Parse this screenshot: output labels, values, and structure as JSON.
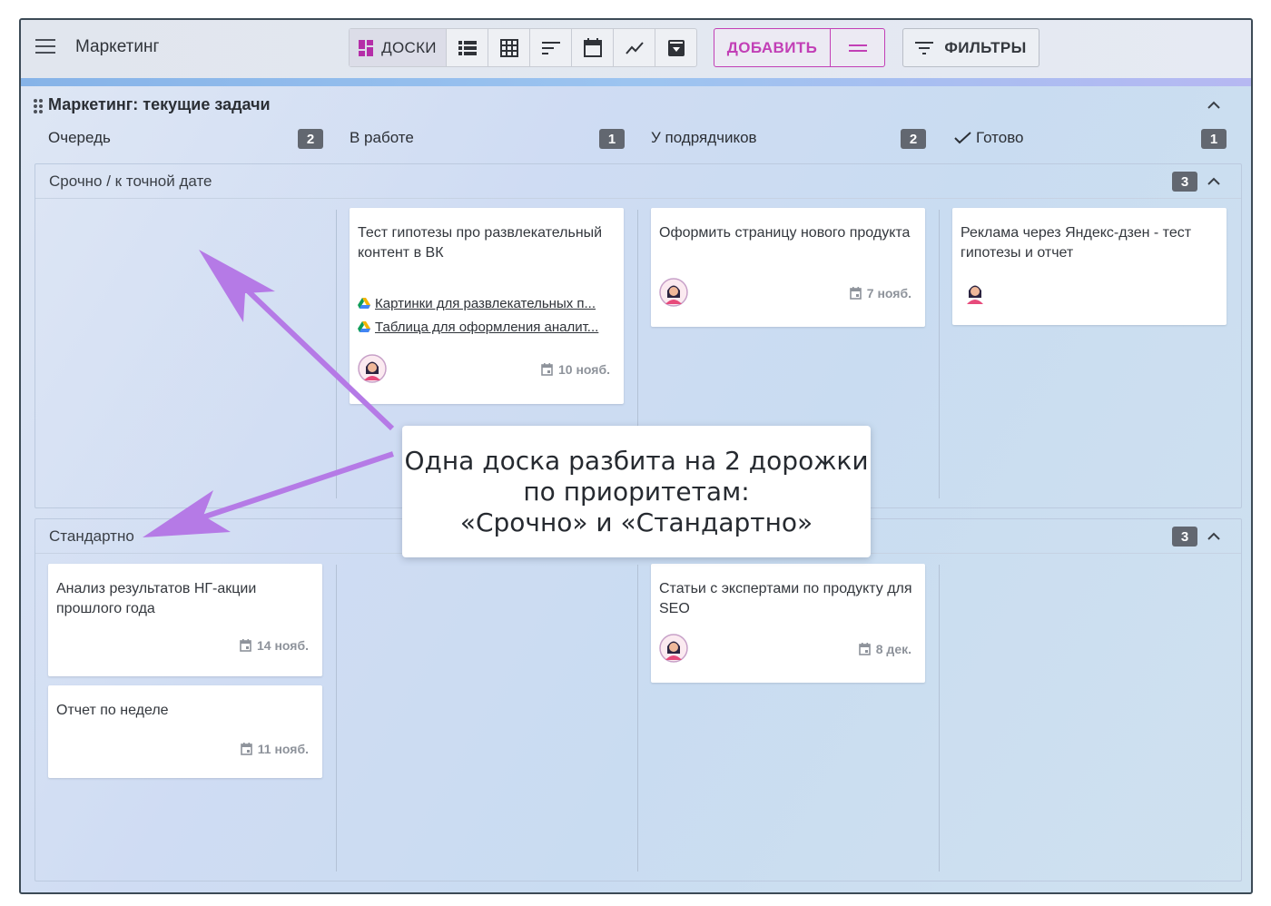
{
  "header": {
    "app_title": "Маркетинг",
    "views": [
      {
        "label": "ДОСКИ",
        "icon": "board-icon",
        "active": true
      },
      {
        "icon": "list-icon"
      },
      {
        "icon": "table-icon"
      },
      {
        "icon": "sort-icon"
      },
      {
        "icon": "calendar-icon"
      },
      {
        "icon": "chart-icon"
      },
      {
        "icon": "archive-icon"
      }
    ],
    "add_label": "ДОБАВИТЬ",
    "filter_label": "ФИЛЬТРЫ"
  },
  "board": {
    "title": "Маркетинг: текущие задачи",
    "columns": [
      {
        "name": "Очередь",
        "count": "2"
      },
      {
        "name": "В работе",
        "count": "1"
      },
      {
        "name": "У подрядчиков",
        "count": "2"
      },
      {
        "name": "Готово",
        "count": "1",
        "check": true
      }
    ]
  },
  "lanes": [
    {
      "name": "Срочно / к точной дате",
      "count": "3",
      "cards": [
        {
          "title": "Тест гипотезы про развлекательный контент в ВК",
          "attachments": [
            "Картинки для развлекательных п...",
            "Таблица для оформления аналит..."
          ],
          "date": "10 нояб."
        },
        {
          "title": "Оформить страницу нового продукта",
          "date": "7 нояб."
        },
        {
          "title": "Реклама через Яндекс-дзен - тест гипотезы и отчет"
        }
      ]
    },
    {
      "name": "Стандартно",
      "count": "3",
      "cards": [
        {
          "title": "Анализ результатов НГ-акции прошлого года",
          "date": "14 нояб."
        },
        {
          "title": "Отчет по неделе",
          "date": "11 нояб."
        },
        {
          "title": "Статьи с экспертами по продукту для SEO",
          "date": "8 дек."
        }
      ]
    }
  ],
  "callout": {
    "text": "Одна доска разбита на 2 дорожки\nпо приоритетам:\n«Срочно» и «Стандартно»"
  },
  "colors": {
    "accent": "#c23fb6",
    "badge": "#626770",
    "arrow": "#b57ae6"
  }
}
